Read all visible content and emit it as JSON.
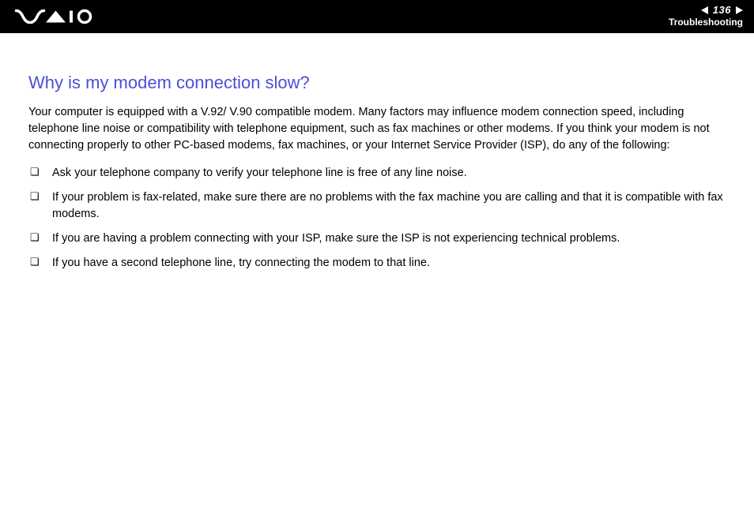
{
  "header": {
    "page_number": "136",
    "section": "Troubleshooting"
  },
  "article": {
    "title": "Why is my modem connection slow?",
    "intro": "Your computer is equipped with a V.92/ V.90 compatible modem. Many factors may influence modem connection speed, including telephone line noise or compatibility with telephone equipment, such as fax machines or other modems. If you think your modem is not connecting properly to other PC-based modems, fax machines, or your Internet Service Provider (ISP), do any of the following:",
    "bullets": [
      "Ask your telephone company to verify your telephone line is free of any line noise.",
      "If your problem is fax-related, make sure there are no problems with the fax machine you are calling and that it is compatible with fax modems.",
      "If you are having a problem connecting with your ISP, make sure the ISP is not experiencing technical problems.",
      "If you have a second telephone line, try connecting the modem to that line."
    ]
  }
}
